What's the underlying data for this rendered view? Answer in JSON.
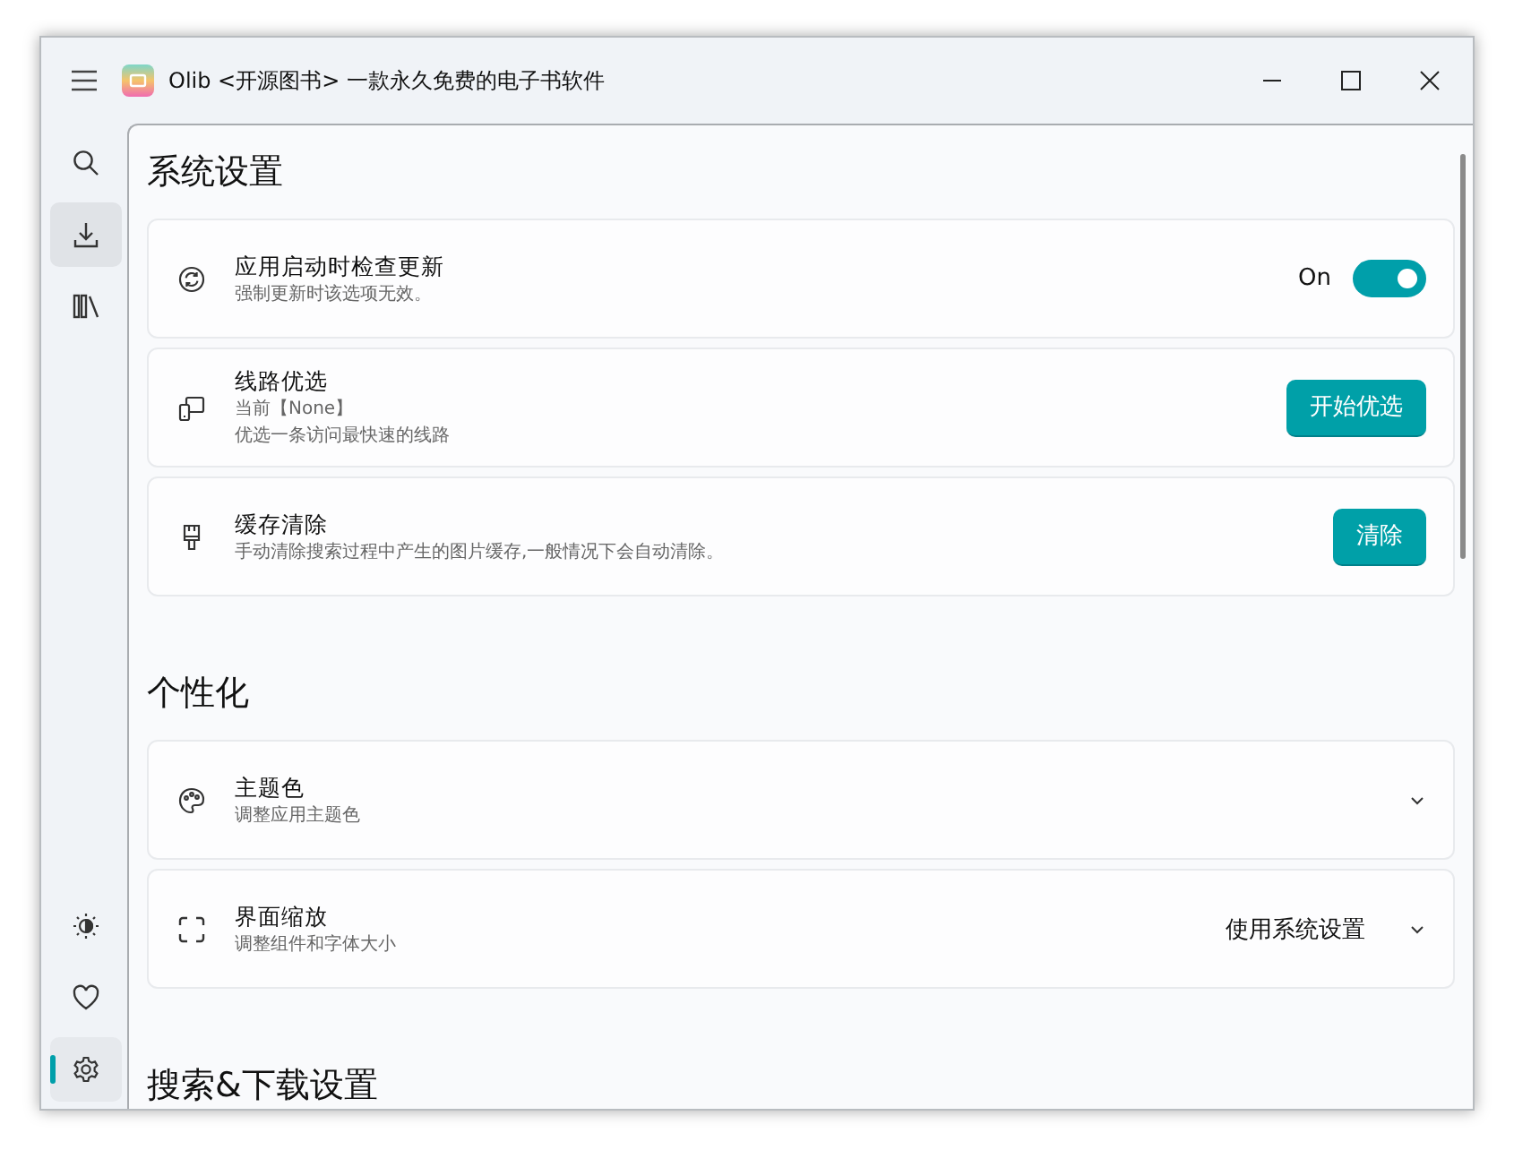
{
  "window": {
    "title": "Olib <开源图书> 一款永久免费的电子书软件"
  },
  "nav": {
    "top": [
      {
        "selected": false,
        "hovered": false
      },
      {
        "selected": false,
        "hovered": true
      },
      {
        "selected": false,
        "hovered": false
      }
    ],
    "bottom": [
      {
        "selected": false,
        "hovered": false
      },
      {
        "selected": false,
        "hovered": false
      },
      {
        "selected": true,
        "hovered": false
      }
    ]
  },
  "sections": [
    {
      "title": "系统设置",
      "items": [
        {
          "kind": "toggle",
          "title": "应用启动时检查更新",
          "lines": [
            "强制更新时该选项无效。"
          ],
          "state_label": "On",
          "on": true
        },
        {
          "kind": "button",
          "title": "线路优选",
          "lines": [
            "当前【None】",
            "优选一条访问最快速的线路"
          ],
          "button": "开始优选"
        },
        {
          "kind": "button",
          "title": "缓存清除",
          "lines": [
            "手动清除搜索过程中产生的图片缓存,一般情况下会自动清除。"
          ],
          "button": "清除"
        }
      ]
    },
    {
      "title": "个性化",
      "items": [
        {
          "kind": "dropdown",
          "title": "主题色",
          "lines": [
            "调整应用主题色"
          ]
        },
        {
          "kind": "dropdown",
          "title": "界面缩放",
          "lines": [
            "调整组件和字体大小"
          ],
          "value": "使用系统设置"
        }
      ]
    },
    {
      "title": "搜索&下载设置"
    }
  ]
}
